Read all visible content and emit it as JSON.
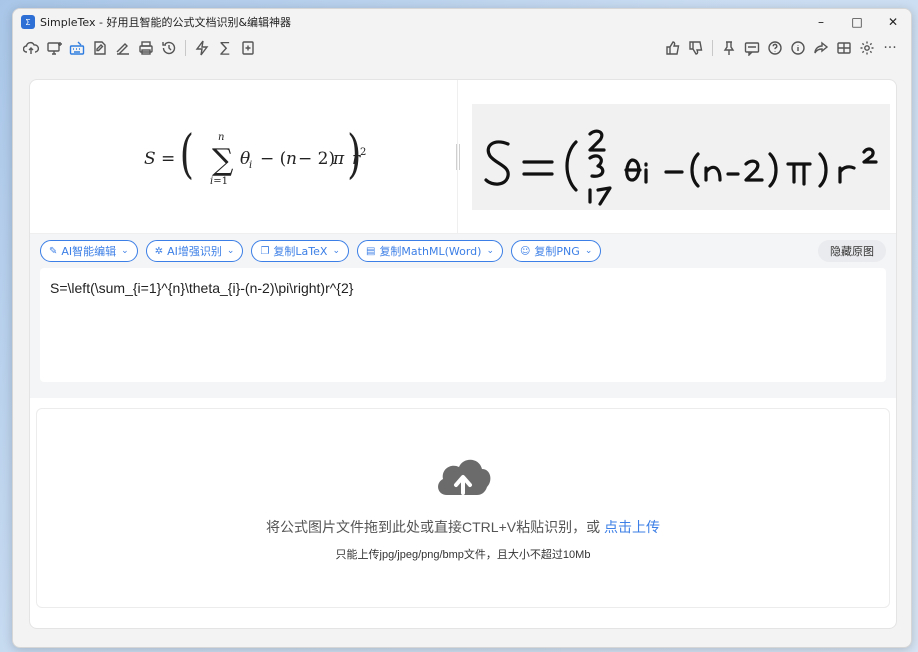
{
  "window": {
    "title": "SimpleTex - 好用且智能的公式文档识别&编辑神器",
    "app_icon_text": "Σ",
    "controls": {
      "minimize": "–",
      "maximize": "□",
      "close": "✕"
    }
  },
  "toolbar": {
    "left_icons": [
      "upload-cloud-icon",
      "screenshot-icon",
      "handwriting-keyboard-icon",
      "edit-document-icon",
      "pen-sign-icon",
      "pdf-print-icon",
      "history-icon",
      "flash-icon",
      "sum-icon",
      "add-file-icon"
    ],
    "right_icons": [
      "thumbs-up-icon",
      "thumbs-down-icon",
      "pin-icon",
      "chat-icon",
      "help-icon",
      "info-icon",
      "share-icon",
      "grid-icon",
      "settings-icon",
      "more-icon"
    ],
    "more_label": "···",
    "sum_glyph": "∑"
  },
  "preview": {
    "latex_rendered_label": "S = (∑ θi − (n−2)π) r²",
    "handwritten_alt": "handwritten formula"
  },
  "actions": {
    "ai_edit": "AI智能编辑",
    "ai_enhance": "AI增强识别",
    "copy_latex": "复制LaTeX",
    "copy_mathml": "复制MathML(Word)",
    "copy_png": "复制PNG",
    "hide_original": "隐藏原图"
  },
  "latex": {
    "value": "S=\\left(\\sum_{i=1}^{n}\\theta_{i}-(n-2)\\pi\\right)r^{2}"
  },
  "upload": {
    "main_text": "将公式图片文件拖到此处或直接CTRL+V粘贴识别，或 ",
    "link_text": "点击上传",
    "sub_text": "只能上传jpg/jpeg/png/bmp文件，且大小不超过10Mb"
  },
  "colors": {
    "accent": "#3c7fe6",
    "cloud": "#6b6b6b"
  }
}
